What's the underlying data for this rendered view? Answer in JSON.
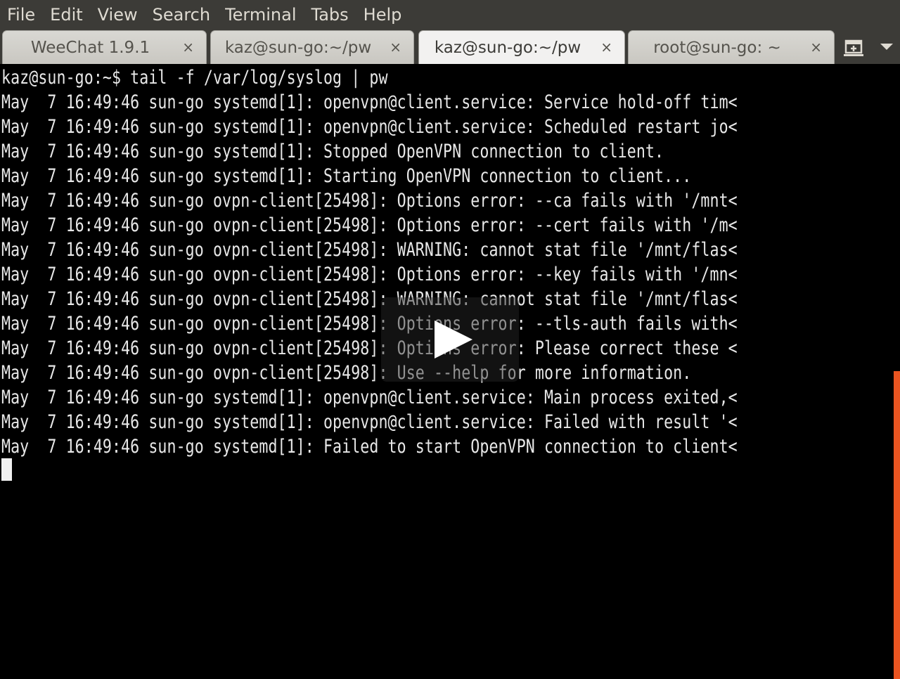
{
  "menu": [
    "File",
    "Edit",
    "View",
    "Search",
    "Terminal",
    "Tabs",
    "Help"
  ],
  "tabs": [
    {
      "label": "WeeChat 1.9.1",
      "close": "×",
      "active": false
    },
    {
      "label": "kaz@sun-go:~/pw",
      "close": "×",
      "active": false
    },
    {
      "label": "kaz@sun-go:~/pw",
      "close": "×",
      "active": true
    },
    {
      "label": "root@sun-go: ~",
      "close": "×",
      "active": false
    }
  ],
  "tab_buttons": {
    "new_tab_icon": "new-tab-icon",
    "tab_list_icon": "chevron-down-icon"
  },
  "terminal": {
    "lines": [
      "kaz@sun-go:~$ tail -f /var/log/syslog | pw",
      "May  7 16:49:46 sun-go systemd[1]: openvpn@client.service: Service hold-off tim<",
      "May  7 16:49:46 sun-go systemd[1]: openvpn@client.service: Scheduled restart jo<",
      "May  7 16:49:46 sun-go systemd[1]: Stopped OpenVPN connection to client.",
      "May  7 16:49:46 sun-go systemd[1]: Starting OpenVPN connection to client...",
      "May  7 16:49:46 sun-go ovpn-client[25498]: Options error: --ca fails with '/mnt<",
      "May  7 16:49:46 sun-go ovpn-client[25498]: Options error: --cert fails with '/m<",
      "May  7 16:49:46 sun-go ovpn-client[25498]: WARNING: cannot stat file '/mnt/flas<",
      "May  7 16:49:46 sun-go ovpn-client[25498]: Options error: --key fails with '/mn<",
      "May  7 16:49:46 sun-go ovpn-client[25498]: WARNING: cannot stat file '/mnt/flas<",
      "May  7 16:49:46 sun-go ovpn-client[25498]: Options error: --tls-auth fails with<",
      "May  7 16:49:46 sun-go ovpn-client[25498]: Options error: Please correct these <",
      "May  7 16:49:46 sun-go ovpn-client[25498]: Use --help for more information.",
      "May  7 16:49:46 sun-go systemd[1]: openvpn@client.service: Main process exited,<",
      "May  7 16:49:46 sun-go systemd[1]: openvpn@client.service: Failed with result '<",
      "May  7 16:49:46 sun-go systemd[1]: Failed to start OpenVPN connection to client<"
    ]
  },
  "colors": {
    "menubar_bg": "#3c3b37",
    "terminal_bg": "#000000",
    "terminal_fg": "#e8e8e8",
    "scrollbar_thumb": "#e95420"
  },
  "overlay": {
    "icon": "play-icon"
  }
}
